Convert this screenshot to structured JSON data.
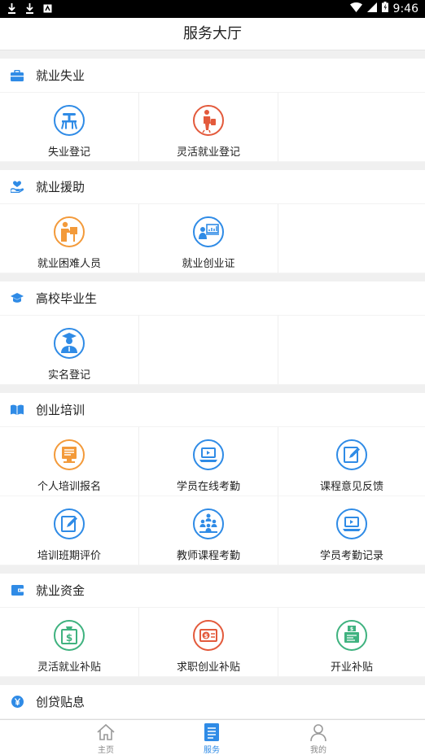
{
  "status_bar": {
    "time": "9:46"
  },
  "header": {
    "title": "服务大厅"
  },
  "colors": {
    "accent": "#2f8be6",
    "orange": "#f39a3a",
    "red": "#e35a3c",
    "green": "#3fb27f"
  },
  "sections": [
    {
      "title": "就业失业",
      "icon": "briefcase-icon",
      "items": [
        "失业登记",
        "灵活就业登记"
      ]
    },
    {
      "title": "就业援助",
      "icon": "helping-hand-icon",
      "items": [
        "就业困难人员",
        "就业创业证"
      ]
    },
    {
      "title": "高校毕业生",
      "icon": "graduation-cap-icon",
      "items": [
        "实名登记"
      ]
    },
    {
      "title": "创业培训",
      "icon": "book-icon",
      "items": [
        "个人培训报名",
        "学员在线考勤",
        "课程意见反馈",
        "培训班期评价",
        "教师课程考勤",
        "学员考勤记录"
      ]
    },
    {
      "title": "就业资金",
      "icon": "wallet-icon",
      "items": [
        "灵活就业补贴",
        "求职创业补贴",
        "开业补贴"
      ]
    },
    {
      "title": "创贷贴息",
      "icon": "yuan-icon",
      "items": []
    }
  ],
  "bottom_nav": [
    {
      "label": "主页",
      "icon": "home-icon"
    },
    {
      "label": "服务",
      "icon": "service-list-icon"
    },
    {
      "label": "我的",
      "icon": "user-icon"
    }
  ]
}
